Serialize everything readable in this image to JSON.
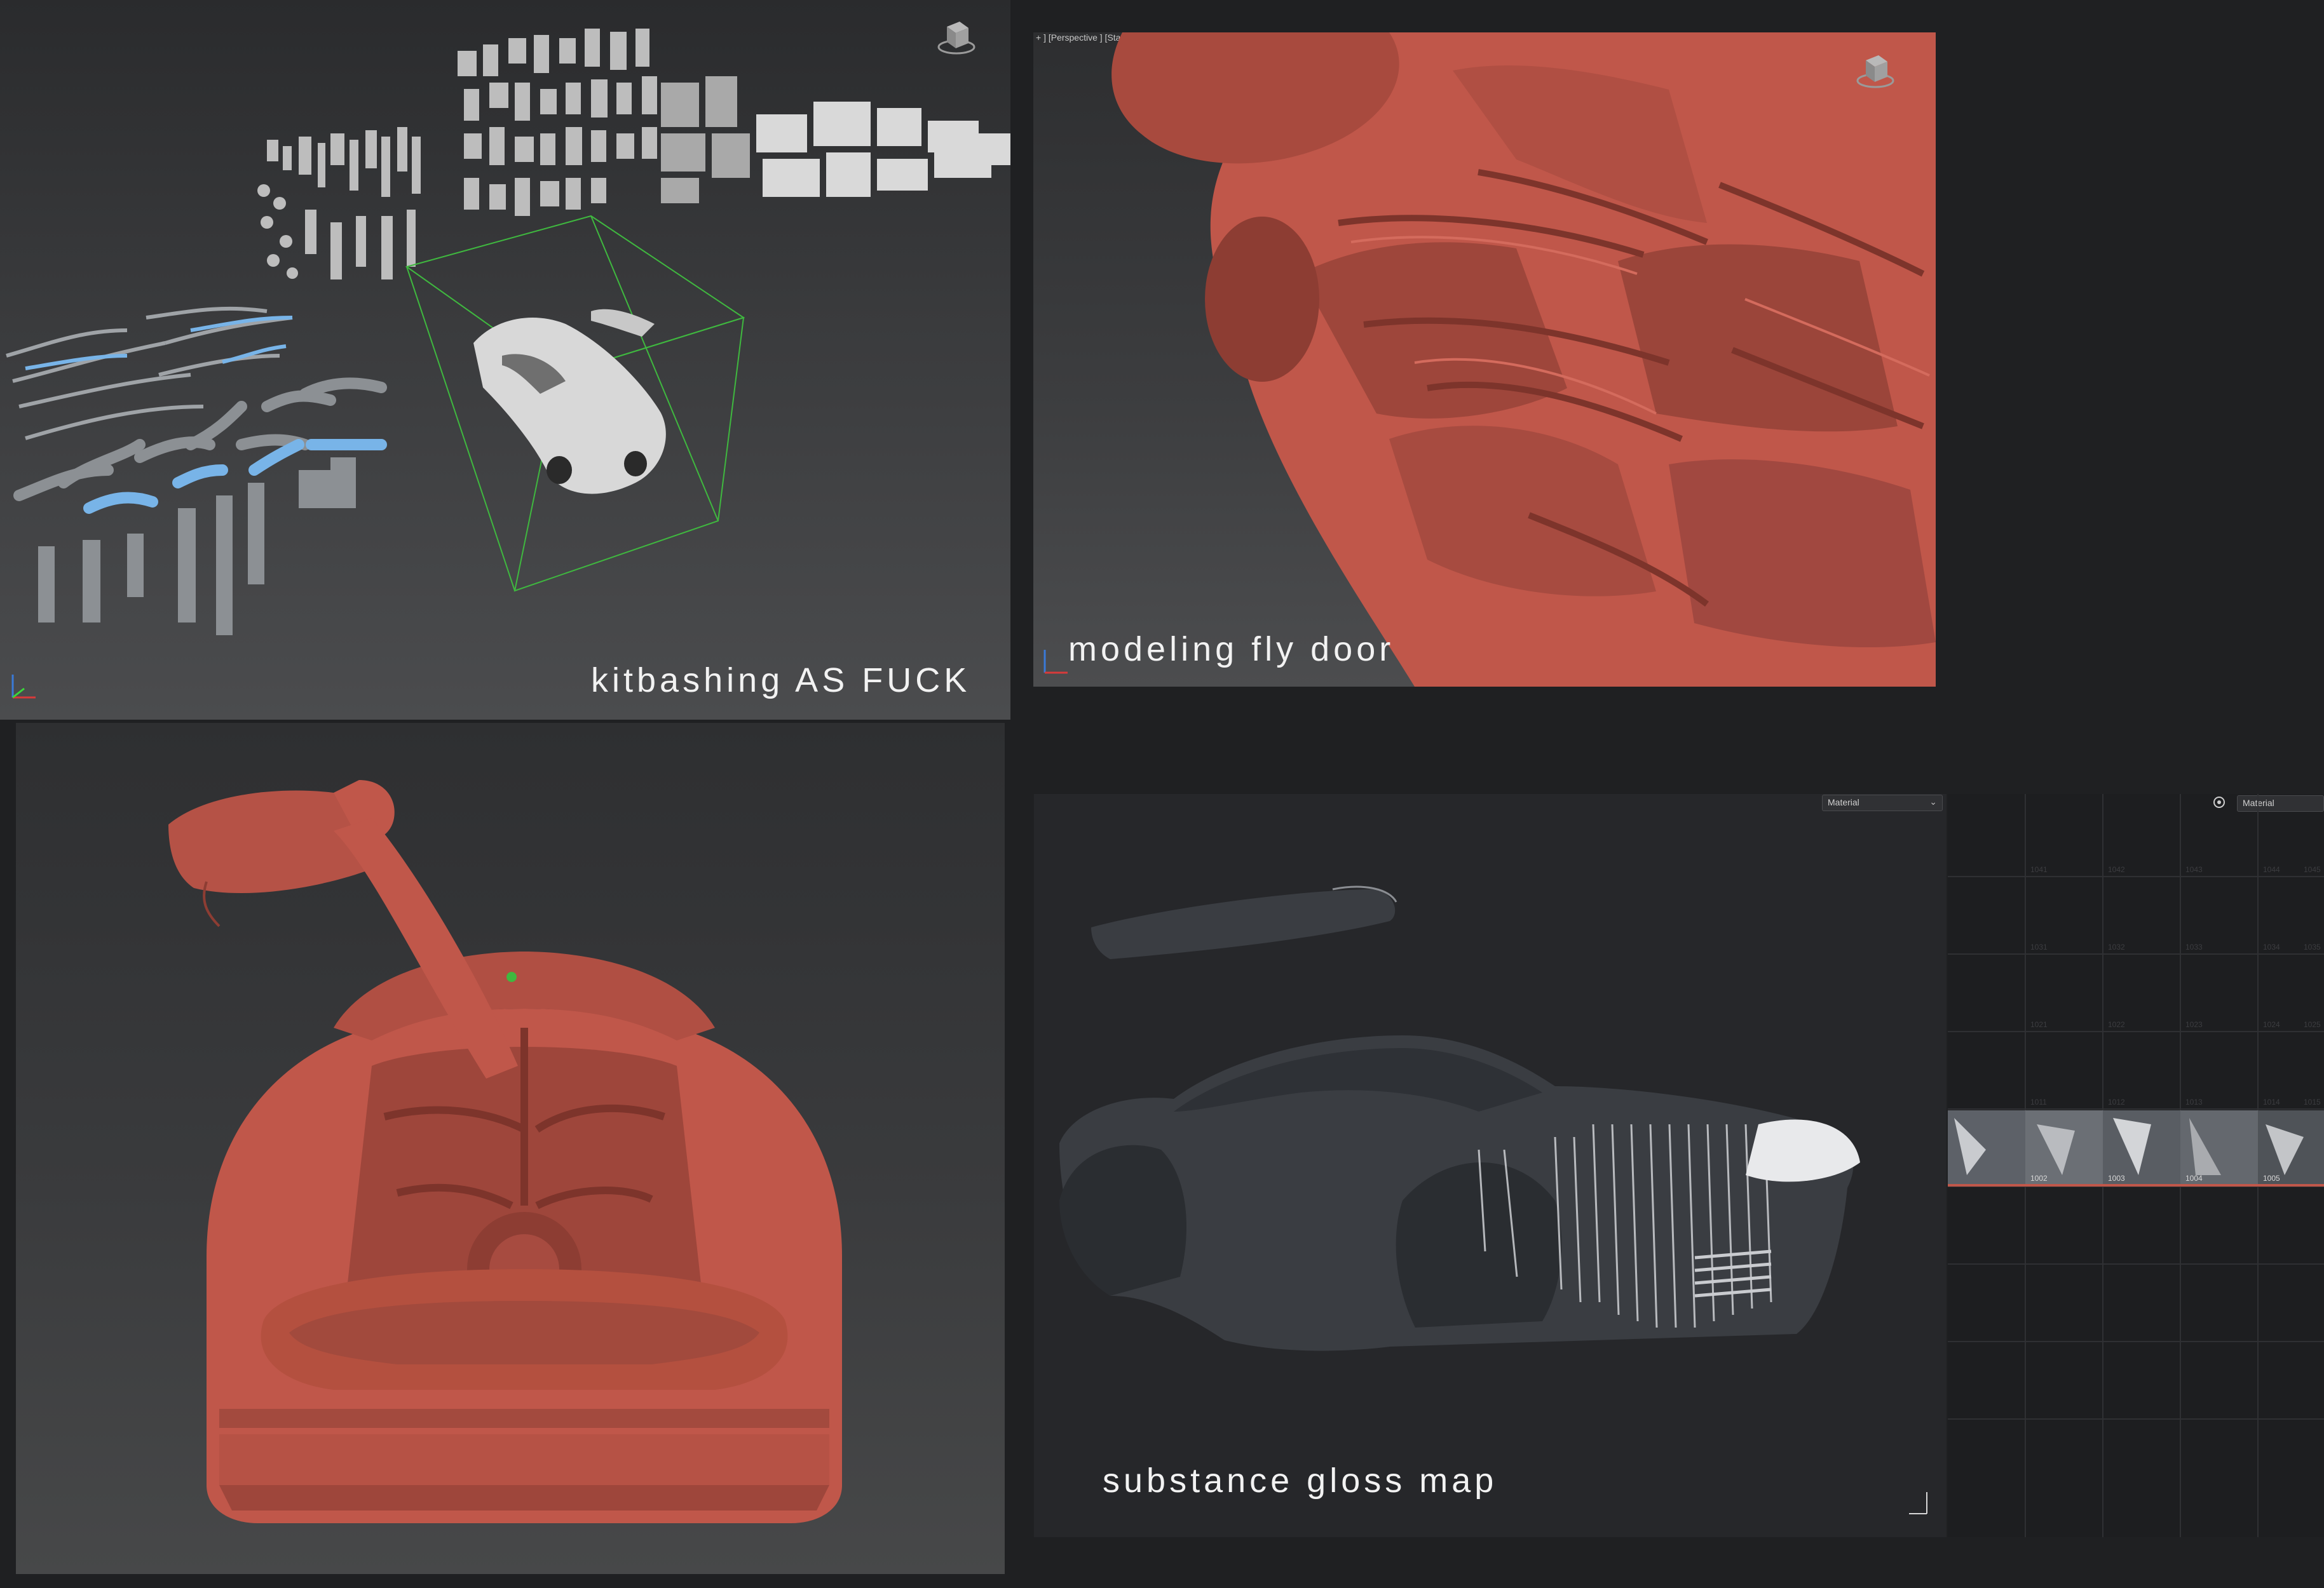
{
  "panels": {
    "kitbash": {
      "caption": "kitbashing AS FUCK"
    },
    "flydoor": {
      "caption": "modeling fly door",
      "viewport_header": "+ ] [Perspective ] [Standard ] [Clay ]"
    },
    "rear": {
      "caption": ""
    },
    "substance": {
      "caption": "substance gloss map",
      "material_dropdown": "Material"
    },
    "uv_editor": {
      "material_dropdown": "Material",
      "tile_labels": [
        "1002",
        "1003",
        "1004",
        "1005"
      ],
      "grid_numbers": [
        "1041",
        "1042",
        "1043",
        "1044",
        "1045",
        "1031",
        "1032",
        "1033",
        "1034",
        "1035",
        "1021",
        "1022",
        "1023",
        "1024",
        "1025",
        "1011",
        "1012",
        "1013",
        "1014",
        "1015"
      ]
    }
  },
  "colors": {
    "clay_red": "#c0574a",
    "selection_green": "#3fb83f",
    "background": "#1f2022",
    "gloss_dark": "#3a3d42"
  },
  "icons": {
    "viewcube": "viewcube-icon",
    "axis": "axis-gizmo-icon"
  }
}
